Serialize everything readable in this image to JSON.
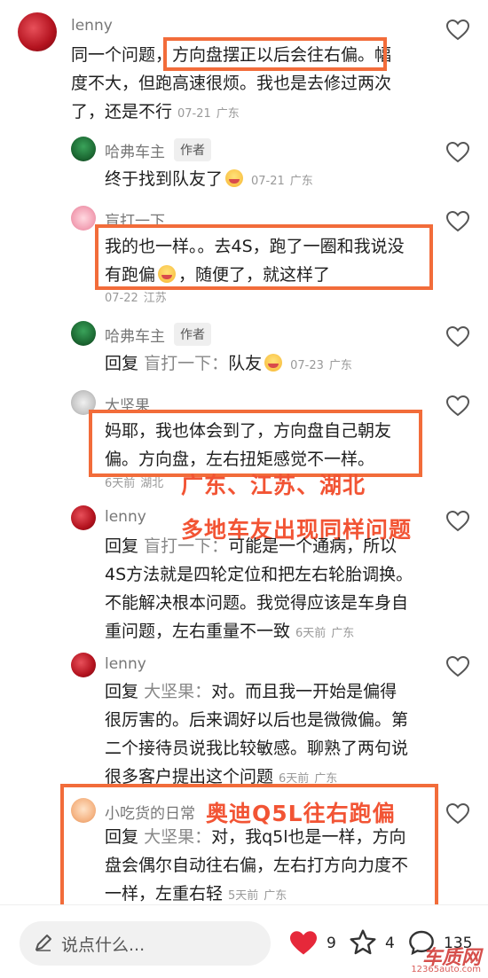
{
  "comments": [
    {
      "author": "lenny",
      "text": "同一个问题，方向盘摆正以后会往右偏。幅度不大，但跑高速很烦。我也是去修过两次了，还是不行",
      "line1": "同一个问题，",
      "line1b": "方向盘摆正以后会往右偏。",
      "line1c": "幅",
      "line2": "度不大，但跑高速很烦。我也是去修过两次",
      "line3": "了，还是不行",
      "date": "07-21",
      "location": "广东"
    },
    {
      "author": "哈弗车主",
      "tag": "作者",
      "text": "终于找到队友了",
      "date": "07-21",
      "location": "广东"
    },
    {
      "author": "盲打一下",
      "line1": "我的也一样。。去4S，跑了一圈和我说没",
      "line2a": "有跑偏",
      "line2b": "，随便了，就这样了",
      "date": "07-22",
      "location": "江苏"
    },
    {
      "author": "哈弗车主",
      "tag": "作者",
      "reply_prefix": "回复",
      "reply_to": "盲打一下：",
      "text": "队友",
      "date": "07-23",
      "location": "广东"
    },
    {
      "author": "大坚果",
      "line1": "妈耶，我也体会到了，方向盘自己朝友",
      "line2": "偏。方向盘，左右扭矩感觉不一样。",
      "date": "6天前",
      "location": "湖北"
    },
    {
      "author": "lenny",
      "reply_prefix": "回复",
      "reply_to": "盲打一下：",
      "line1": "可能是一个通病，所以",
      "line2": "4S方法就是四轮定位和把左右轮胎调换。",
      "line3": "不能解决根本问题。我觉得应该是车身自",
      "line4": "重问题，左右重量不一致",
      "date": "6天前",
      "location": "广东"
    },
    {
      "author": "lenny",
      "reply_prefix": "回复",
      "reply_to": "大坚果：",
      "line1": "对。而且我一开始是偏得",
      "line2": "很厉害的。后来调好以后也是微微偏。第",
      "line3": "二个接待员说我比较敏感。聊熟了两句说",
      "line4": "很多客户提出这个问题",
      "date": "6天前",
      "location": "广东"
    },
    {
      "author": "小吃货的日常",
      "reply_prefix": "回复",
      "reply_to": "大坚果：",
      "line1": "对，我q5l也是一样，方向",
      "line2": "盘会偶尔自动往右偏，左右打方向力度不",
      "line3": "一样，左重右轻",
      "date": "5天前",
      "location": "广东"
    }
  ],
  "overlays": {
    "regions": "广东、江苏、湖北",
    "same_issue": "多地车友出现同样问题",
    "q5l": "奥迪Q5L往右跑偏"
  },
  "bottom_bar": {
    "input_placeholder": "说点什么...",
    "like_count": "9",
    "favorite_count": "4",
    "comment_count": "135"
  },
  "watermark": {
    "brand": "车质网",
    "url": "12365auto.com"
  },
  "colors": {
    "highlight_box": "#f26c3a",
    "overlay_text": "#f25434",
    "like_red": "#e6283a"
  }
}
